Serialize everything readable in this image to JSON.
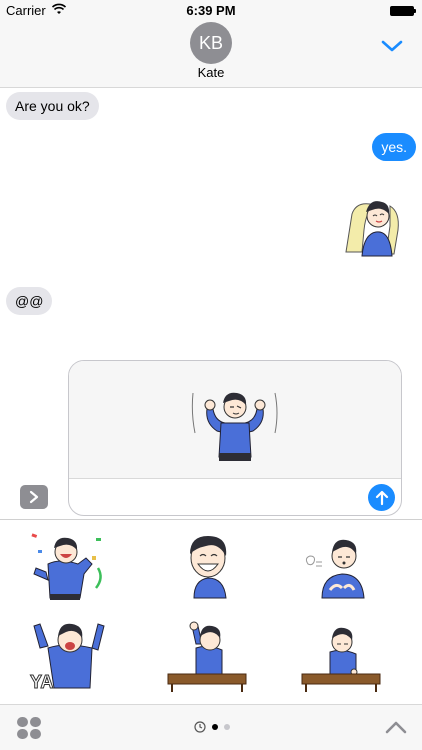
{
  "status_bar": {
    "carrier": "Carrier",
    "time": "6:39 PM"
  },
  "header": {
    "avatar_initials": "KB",
    "contact_name": "Kate"
  },
  "messages": [
    {
      "direction": "incoming",
      "text": "Are you ok?"
    },
    {
      "direction": "outgoing",
      "text": "yes."
    },
    {
      "direction": "outgoing",
      "sticker": "relaxing-in-chair"
    },
    {
      "direction": "incoming",
      "text": "@@"
    }
  ],
  "compose": {
    "preview_sticker": "flexing-arms-up"
  },
  "drawer": {
    "stickers": [
      "confetti-celebrate",
      "big-grin",
      "sighing-hands-on-chest",
      "yay-shout",
      "desk-raise-fist",
      "desk-tired"
    ],
    "page_dots": 2,
    "active_dot": 0
  },
  "colors": {
    "accent": "#1a8cff",
    "incoming_bubble": "#e5e5ea",
    "avatar": "#8e8e93",
    "shirt": "#4a6fd8"
  }
}
